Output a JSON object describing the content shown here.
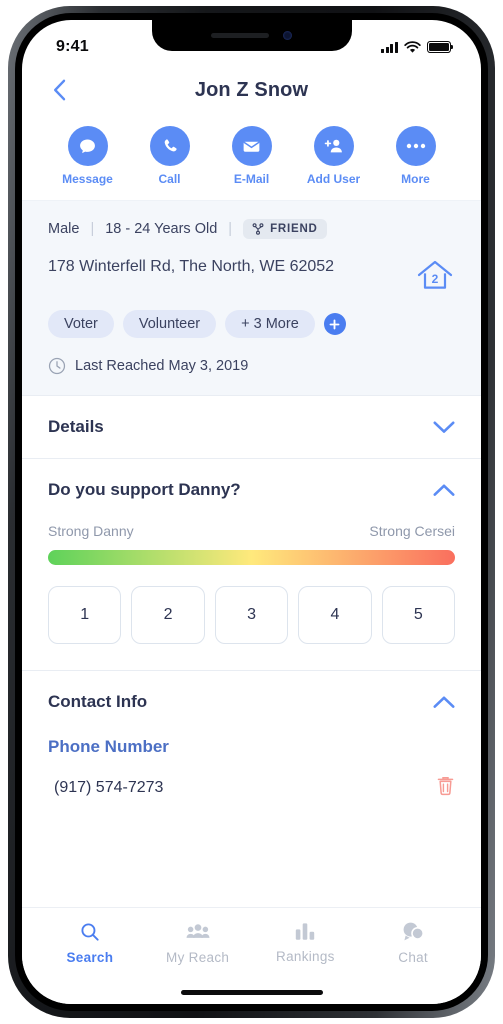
{
  "status_bar": {
    "time": "9:41",
    "signal_icon": "signal-bars-icon",
    "wifi_icon": "wifi-icon",
    "battery_icon": "battery-full-icon"
  },
  "header": {
    "title": "Jon Z Snow",
    "back_icon": "chevron-left-icon"
  },
  "actions": [
    {
      "label": "Message",
      "icon": "message-bubble-icon"
    },
    {
      "label": "Call",
      "icon": "phone-icon"
    },
    {
      "label": "E-Mail",
      "icon": "envelope-icon"
    },
    {
      "label": "Add User",
      "icon": "add-user-icon"
    },
    {
      "label": "More",
      "icon": "ellipsis-icon"
    }
  ],
  "info": {
    "gender": "Male",
    "age_range": "18 - 24 Years Old",
    "relationship_badge": "FRIEND",
    "relationship_icon": "network-nodes-icon",
    "address": "178 Winterfell Rd, The North, WE 62052",
    "household_count": "2",
    "household_icon": "house-icon",
    "tags": [
      "Voter",
      "Volunteer",
      "+ 3 More"
    ],
    "add_tag_icon": "plus-icon",
    "last_reached": "Last Reached May 3, 2019",
    "clock_icon": "clock-icon"
  },
  "sections": {
    "details": {
      "title": "Details",
      "expanded": false,
      "chevron_icon": "chevron-down-icon"
    },
    "support": {
      "title": "Do you support Danny?",
      "expanded": true,
      "chevron_icon": "chevron-up-icon",
      "scale_left_label": "Strong Danny",
      "scale_right_label": "Strong Cersei",
      "gradient_start": "#5ed25a",
      "gradient_mid": "#ffe97c",
      "gradient_end": "#fa6f5e",
      "ratings": [
        "1",
        "2",
        "3",
        "4",
        "5"
      ]
    },
    "contact": {
      "title": "Contact Info",
      "expanded": true,
      "chevron_icon": "chevron-up-icon",
      "field_label": "Phone Number",
      "field_value": "(917) 574-7273",
      "delete_icon": "trash-icon",
      "delete_color": "#f79b94"
    }
  },
  "tabs": [
    {
      "label": "Search",
      "icon": "magnifier-icon",
      "active": true
    },
    {
      "label": "My Reach",
      "icon": "people-group-icon",
      "active": false
    },
    {
      "label": "Rankings",
      "icon": "bar-chart-icon",
      "active": false
    },
    {
      "label": "Chat",
      "icon": "chat-bubble-icon",
      "active": false
    }
  ],
  "theme": {
    "accent": "#4a7df0",
    "action_blue": "#5b8cf5",
    "title_navy": "#2d3452",
    "info_bg": "#f4f7fb"
  }
}
